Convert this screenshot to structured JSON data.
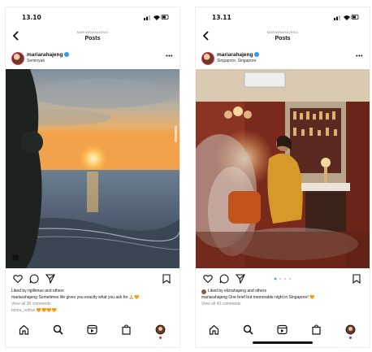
{
  "left": {
    "status_time": "13.10",
    "header_username": "MARIARAHAJENG",
    "header_title": "Posts",
    "post_username": "mariarahajeng",
    "post_location": "Seminyak",
    "liked_by": "Liked by rigillenus and others",
    "caption": "mariarahajeng Sometimes life gives you exactly what you ask for 🙏🧡",
    "view_comments": "View all 38 comments",
    "comment_preview": "tahira_nofriar 🧡🧡🧡🧡"
  },
  "right": {
    "status_time": "13.11",
    "header_username": "MARIARAHAJENG",
    "header_title": "Posts",
    "post_username": "mariarahajeng",
    "post_location": "Singapore, Singapore",
    "liked_by": "Liked by elizrahajeng and others",
    "caption": "mariarahajeng One brief but memorable night in Singapore! 🧡",
    "view_comments": "View all 43 comments"
  },
  "icons": [
    "back-arrow-icon",
    "verified-icon",
    "more-icon",
    "heart-icon",
    "comment-icon",
    "share-icon",
    "bookmark-icon",
    "home-icon",
    "search-icon",
    "reels-icon",
    "shop-icon",
    "profile-icon"
  ]
}
